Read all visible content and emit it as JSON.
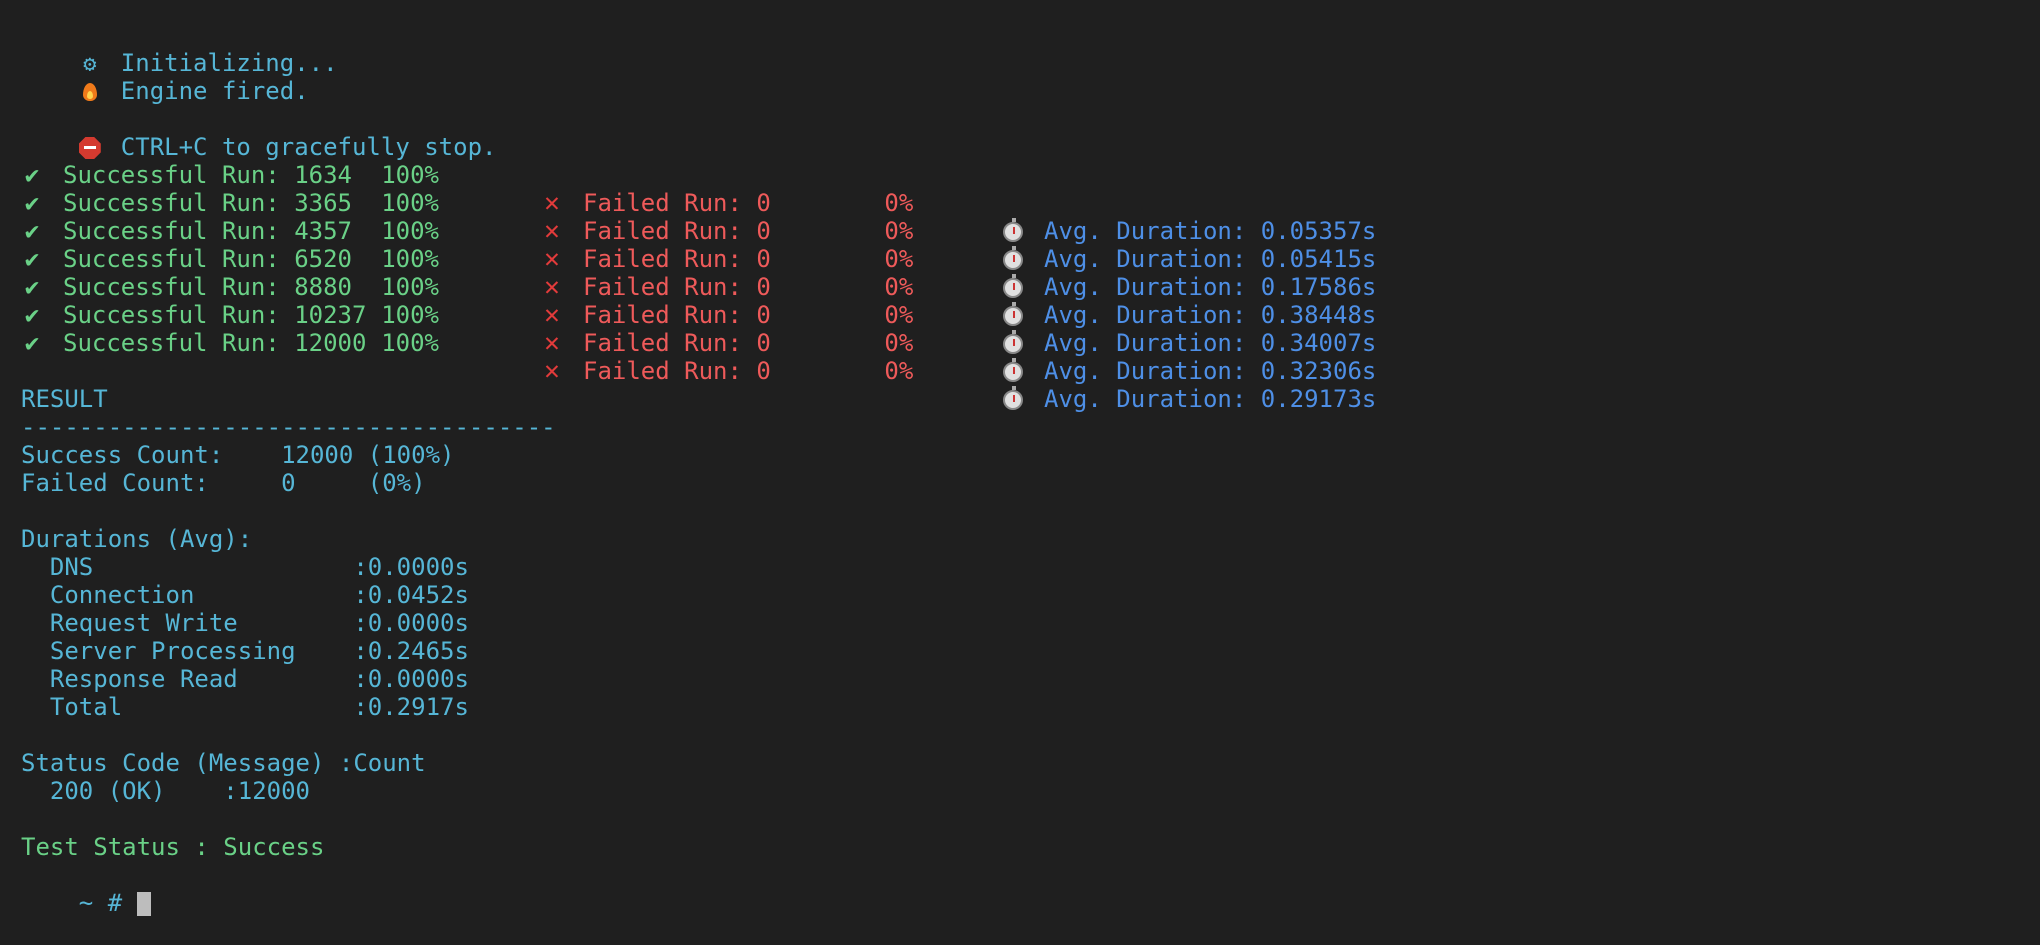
{
  "init": {
    "initializing": "Initializing...",
    "engine": "Engine fired.",
    "stop_hint": "CTRL+C to gracefully stop."
  },
  "runs": [
    {
      "success_label": "Successful Run:",
      "success": "1634",
      "success_pct": "100%",
      "failed_label": "Failed Run:",
      "failed": "0",
      "failed_pct": "0%",
      "avg_label": "Avg. Duration:",
      "avg": "0.05357s"
    },
    {
      "success_label": "Successful Run:",
      "success": "3365",
      "success_pct": "100%",
      "failed_label": "Failed Run:",
      "failed": "0",
      "failed_pct": "0%",
      "avg_label": "Avg. Duration:",
      "avg": "0.05415s"
    },
    {
      "success_label": "Successful Run:",
      "success": "4357",
      "success_pct": "100%",
      "failed_label": "Failed Run:",
      "failed": "0",
      "failed_pct": "0%",
      "avg_label": "Avg. Duration:",
      "avg": "0.17586s"
    },
    {
      "success_label": "Successful Run:",
      "success": "6520",
      "success_pct": "100%",
      "failed_label": "Failed Run:",
      "failed": "0",
      "failed_pct": "0%",
      "avg_label": "Avg. Duration:",
      "avg": "0.38448s"
    },
    {
      "success_label": "Successful Run:",
      "success": "8880",
      "success_pct": "100%",
      "failed_label": "Failed Run:",
      "failed": "0",
      "failed_pct": "0%",
      "avg_label": "Avg. Duration:",
      "avg": "0.34007s"
    },
    {
      "success_label": "Successful Run:",
      "success": "10237",
      "success_pct": "100%",
      "failed_label": "Failed Run:",
      "failed": "0",
      "failed_pct": "0%",
      "avg_label": "Avg. Duration:",
      "avg": "0.32306s"
    },
    {
      "success_label": "Successful Run:",
      "success": "12000",
      "success_pct": "100%",
      "failed_label": "Failed Run:",
      "failed": "0",
      "failed_pct": "0%",
      "avg_label": "Avg. Duration:",
      "avg": "0.29173s"
    }
  ],
  "result": {
    "title": "RESULT",
    "divider": "-------------------------------------",
    "success_count": "Success Count:    12000 (100%)",
    "failed_count": "Failed Count:     0     (0%)",
    "durations_title": "Durations (Avg):",
    "durations": [
      "  DNS                  :0.0000s",
      "  Connection           :0.0452s",
      "  Request Write        :0.0000s",
      "  Server Processing    :0.2465s",
      "  Response Read        :0.0000s",
      "  Total                :0.2917s"
    ],
    "status_header": "Status Code (Message) :Count",
    "status_rows": [
      "  200 (OK)    :12000"
    ],
    "test_status": "Test Status : Success"
  },
  "prompt": {
    "text": "~ # "
  },
  "icons": {
    "init": "gear-icon",
    "engine": "fire-icon",
    "stop": "stop-sign-icon",
    "success": "check-icon",
    "failed": "cross-icon",
    "avg": "stopwatch-icon"
  },
  "colors": {
    "background": "#1f1f1f",
    "info": "#56b6d6",
    "success": "#6ad187",
    "failed": "#ee5a5a",
    "avg": "#4e8fe6"
  }
}
